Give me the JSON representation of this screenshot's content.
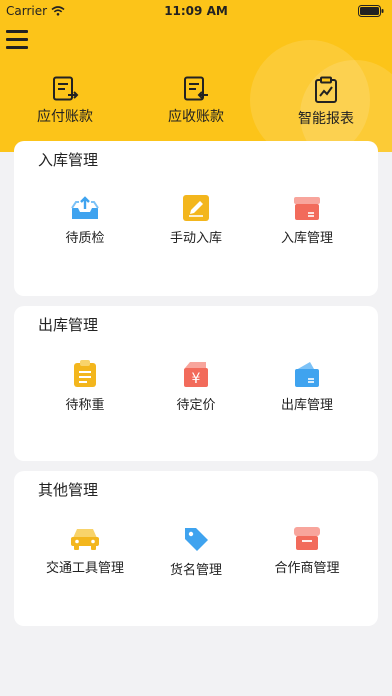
{
  "status_bar": {
    "carrier": "Carrier",
    "time": "11:09 AM"
  },
  "header": {
    "bg_color": "#fcc419",
    "quick_actions": [
      {
        "label": "应付账款",
        "icon": "payable-doc-icon"
      },
      {
        "label": "应收账款",
        "icon": "receivable-doc-icon"
      },
      {
        "label": "智能报表",
        "icon": "report-clipboard-icon"
      }
    ]
  },
  "sections": [
    {
      "title": "入库管理",
      "items": [
        {
          "label": "待质检",
          "icon": "tray-upload-icon"
        },
        {
          "label": "手动入库",
          "icon": "edit-pencil-icon"
        },
        {
          "label": "入库管理",
          "icon": "box-icon"
        }
      ]
    },
    {
      "title": "出库管理",
      "items": [
        {
          "label": "待称重",
          "icon": "clipboard-list-icon"
        },
        {
          "label": "待定价",
          "icon": "yen-tag-icon"
        },
        {
          "label": "出库管理",
          "icon": "card-icon"
        }
      ]
    },
    {
      "title": "其他管理",
      "items": [
        {
          "label": "交通工具管理",
          "icon": "car-icon"
        },
        {
          "label": "货名管理",
          "icon": "tag-icon"
        },
        {
          "label": "合作商管理",
          "icon": "store-icon"
        }
      ]
    }
  ]
}
